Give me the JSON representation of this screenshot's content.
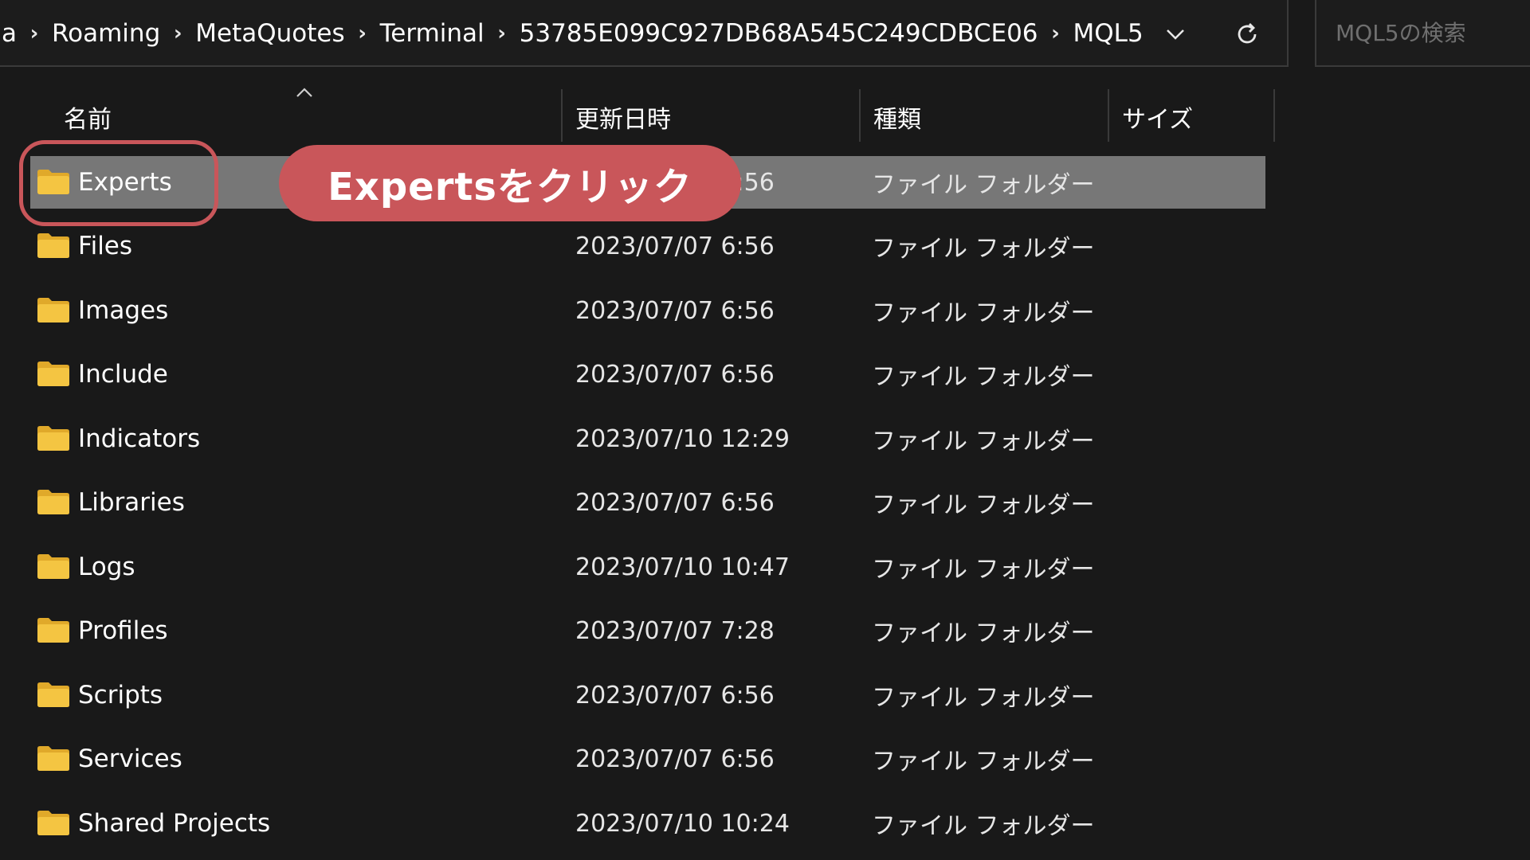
{
  "breadcrumb": {
    "items": [
      "a",
      "Roaming",
      "MetaQuotes",
      "Terminal",
      "53785E099C927DB68A545C249CDBCE06",
      "MQL5"
    ]
  },
  "search": {
    "placeholder": "MQL5の検索"
  },
  "columns": {
    "name": "名前",
    "modified": "更新日時",
    "type": "種類",
    "size": "サイズ"
  },
  "rows": [
    {
      "name": "Experts",
      "date": "2023/07/07 6:56",
      "type": "ファイル フォルダー"
    },
    {
      "name": "Files",
      "date": "2023/07/07 6:56",
      "type": "ファイル フォルダー"
    },
    {
      "name": "Images",
      "date": "2023/07/07 6:56",
      "type": "ファイル フォルダー"
    },
    {
      "name": "Include",
      "date": "2023/07/07 6:56",
      "type": "ファイル フォルダー"
    },
    {
      "name": "Indicators",
      "date": "2023/07/10 12:29",
      "type": "ファイル フォルダー"
    },
    {
      "name": "Libraries",
      "date": "2023/07/07 6:56",
      "type": "ファイル フォルダー"
    },
    {
      "name": "Logs",
      "date": "2023/07/10 10:47",
      "type": "ファイル フォルダー"
    },
    {
      "name": "Profiles",
      "date": "2023/07/07 7:28",
      "type": "ファイル フォルダー"
    },
    {
      "name": "Scripts",
      "date": "2023/07/07 6:56",
      "type": "ファイル フォルダー"
    },
    {
      "name": "Services",
      "date": "2023/07/07 6:56",
      "type": "ファイル フォルダー"
    },
    {
      "name": "Shared Projects",
      "date": "2023/07/10 10:24",
      "type": "ファイル フォルダー"
    }
  ],
  "annotation": {
    "text": "Expertsをクリック"
  },
  "colors": {
    "background": "#191919",
    "selected_row": "#777777",
    "annotation": "#c9565a",
    "folder": "#f4c542"
  },
  "icons": {
    "folder": "folder-icon",
    "breadcrumb_separator": "chevron-right-icon",
    "address_dropdown": "chevron-down-icon",
    "refresh": "refresh-icon",
    "sort": "sort-up-icon"
  }
}
